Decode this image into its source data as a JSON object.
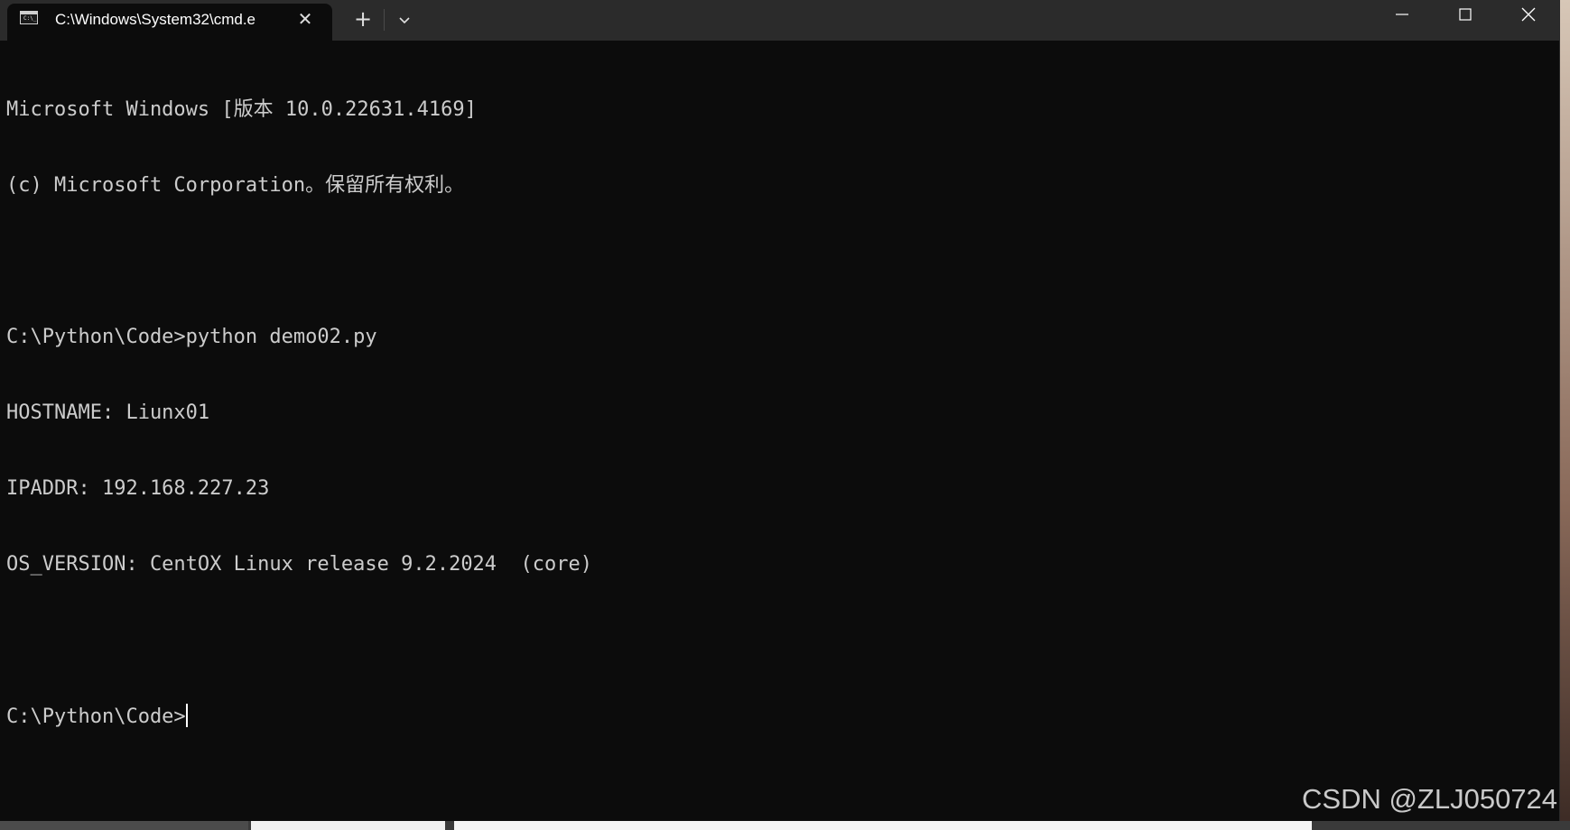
{
  "window": {
    "tab_title": "C:\\Windows\\System32\\cmd.e",
    "tab_icon": "cmd-prompt-icon",
    "tab_icon_text": "C:\\_",
    "new_tab_label": "+",
    "close_tab_label": "✕"
  },
  "console": {
    "lines": [
      "Microsoft Windows [版本 10.0.22631.4169]",
      "(c) Microsoft Corporation。保留所有权利。",
      "",
      "C:\\Python\\Code>python demo02.py",
      "HOSTNAME: Liunx01",
      "IPADDR: 192.168.227.23",
      "OS_VERSION: CentOX Linux release 9.2.2024  (core)",
      "",
      "C:\\Python\\Code>"
    ]
  },
  "watermark": "CSDN @ZLJ050724",
  "colors": {
    "background": "#0c0c0c",
    "titlebar": "#2b2b2b",
    "text": "#cccccc"
  }
}
